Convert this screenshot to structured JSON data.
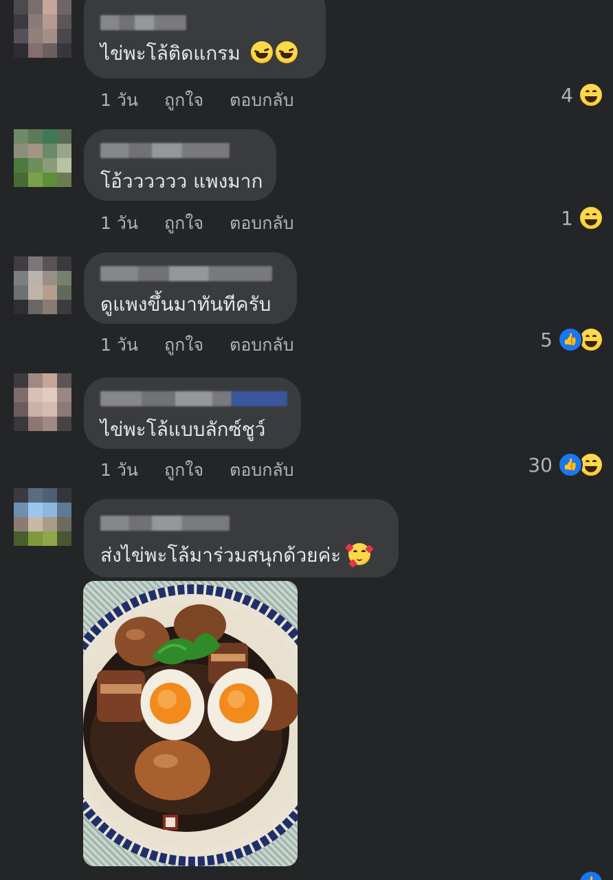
{
  "comments": [
    {
      "text": "ไข่พะโล้ติดแกรม",
      "inline_emoji": "grinning-squinting-face",
      "inline_emoji_count": 2,
      "time": "1 วัน",
      "like_label": "ถูกใจ",
      "reply_label": "ตอบกลับ",
      "reaction_count": "4",
      "reactions": [
        "haha"
      ]
    },
    {
      "text": "โอ้วววววว แพงมาก",
      "time": "1 วัน",
      "like_label": "ถูกใจ",
      "reply_label": "ตอบกลับ",
      "reaction_count": "1",
      "reactions": [
        "haha"
      ]
    },
    {
      "text": "ดูแพงขึ้นมาทันทีครับ",
      "time": "1 วัน",
      "like_label": "ถูกใจ",
      "reply_label": "ตอบกลับ",
      "reaction_count": "5",
      "reactions": [
        "like",
        "haha"
      ]
    },
    {
      "text": "ไข่พะโล้แบบลักซ์ชูว์",
      "time": "1 วัน",
      "like_label": "ถูกใจ",
      "reply_label": "ตอบกลับ",
      "reaction_count": "30",
      "reactions": [
        "like",
        "haha"
      ]
    },
    {
      "text": "ส่งไข่พะโล้มาร่วมสนุกด้วยค่ะ",
      "inline_emoji": "smiling-face-with-hearts",
      "inline_emoji_count": 1,
      "photo": "braised-eggs-and-pork-photo",
      "reactions": [
        "like"
      ]
    }
  ],
  "colors": {
    "background": "#242526",
    "bubble": "#3a3b3c",
    "text": "#e4e6eb",
    "secondary_text": "#b0b3b8",
    "like_blue": "#1877f2",
    "haha_yellow": "#ffd84a"
  }
}
